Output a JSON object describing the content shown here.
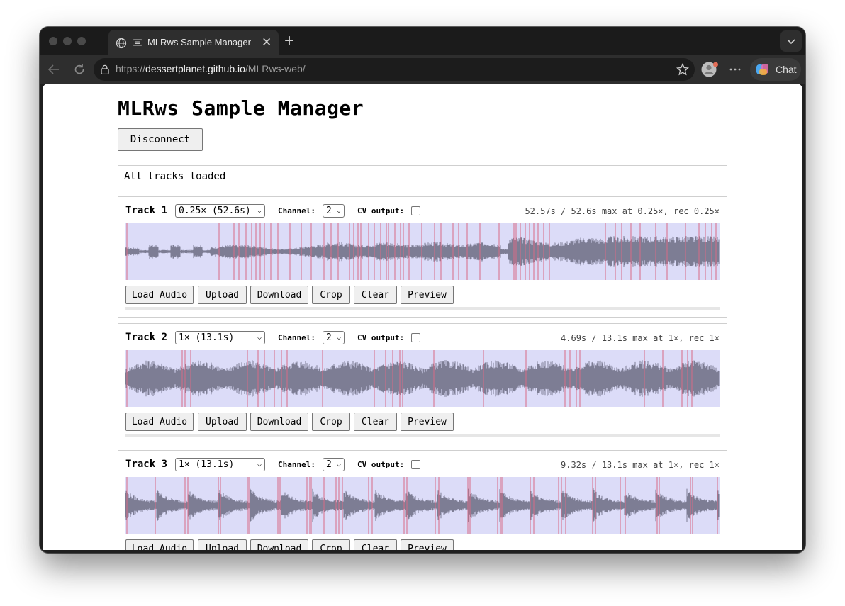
{
  "browser": {
    "tab_title": "MLRws Sample Manager",
    "url_scheme": "https://",
    "url_host": "dessertplanet.github.io",
    "url_path": "/MLRws-web/",
    "chat_label": "Chat",
    "new_tab_glyph": "+",
    "close_glyph": "✕"
  },
  "page": {
    "title": "MLRws Sample Manager",
    "disconnect_label": "Disconnect",
    "status": "All tracks loaded"
  },
  "labels": {
    "channel": "Channel:",
    "cv_output": "CV output:",
    "load_audio": "Load Audio",
    "upload": "Upload",
    "download": "Download",
    "crop": "Crop",
    "clear": "Clear",
    "preview": "Preview"
  },
  "tracks": [
    {
      "label": "Track 1",
      "speed": "0.25× (52.6s)",
      "channel": "2",
      "cv_output": false,
      "info": "52.57s / 52.6s max at 0.25×, rec 0.25×",
      "fill": 1.0
    },
    {
      "label": "Track 2",
      "speed": "1× (13.1s)",
      "channel": "2",
      "cv_output": false,
      "info": "4.69s / 13.1s max at 1×, rec 1×",
      "fill": 1.0
    },
    {
      "label": "Track 3",
      "speed": "1× (13.1s)",
      "channel": "2",
      "cv_output": false,
      "info": "9.32s / 13.1s max at 1×, rec 1×",
      "fill": 1.0
    }
  ],
  "colors": {
    "wave_bg": "#dcdcf8",
    "wave_fg": "#7d7d94",
    "marker": "#d86a86"
  },
  "icons": [
    "globe-icon",
    "keyboard-icon",
    "close-icon",
    "plus-icon",
    "chevron-down-icon",
    "back-icon",
    "reload-icon",
    "lock-icon",
    "star-icon",
    "profile-icon",
    "more-icon",
    "copilot-icon"
  ]
}
